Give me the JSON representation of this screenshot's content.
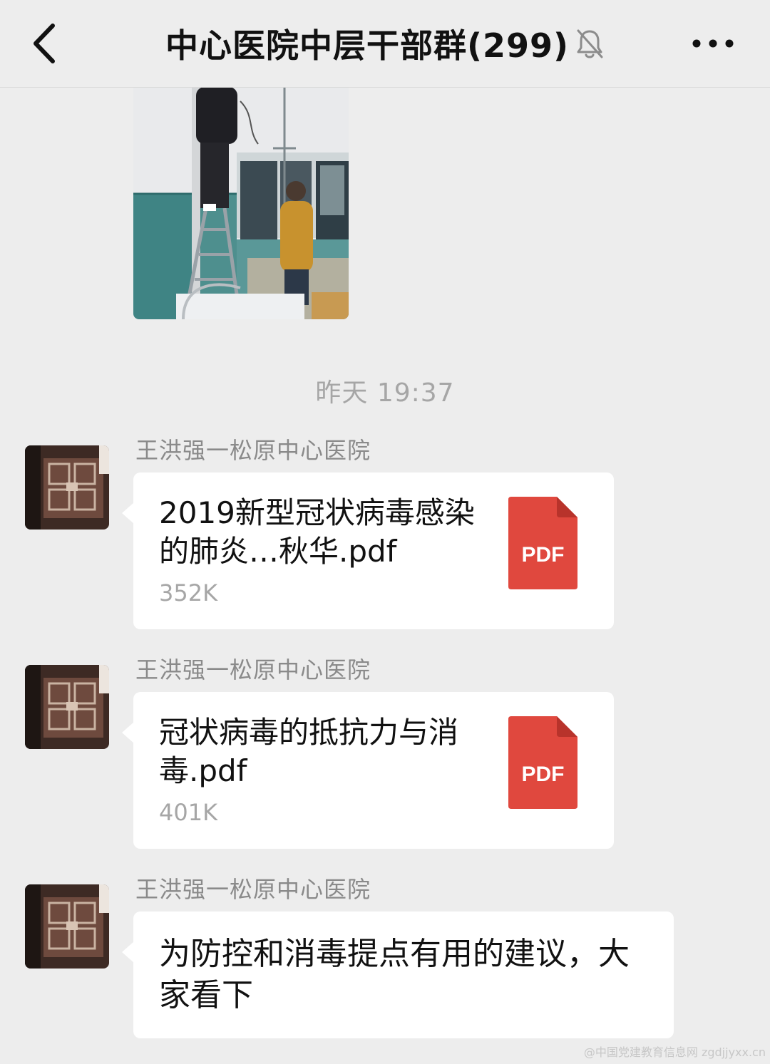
{
  "header": {
    "title": "中心医院中层干部群(299)"
  },
  "time_divider": "昨天 19:37",
  "messages": [
    {
      "sender": "王洪强一松原中心医院",
      "file_name": "2019新型冠状病毒感染的肺炎…秋华.pdf",
      "file_size": "352K",
      "file_type": "PDF"
    },
    {
      "sender": "王洪强一松原中心医院",
      "file_name": "冠状病毒的抵抗力与消毒.pdf",
      "file_size": "401K",
      "file_type": "PDF"
    },
    {
      "sender": "王洪强一松原中心医院",
      "text": "为防控和消毒提点有用的建议，大家看下"
    }
  ],
  "watermark": "@中国党建教育信息网 zgdjjyxx.cn",
  "colors": {
    "page_background": "#ededed",
    "bubble": "#ffffff",
    "pdf_icon": "#e0483e",
    "secondary_text": "#a6a6a6"
  },
  "icons": {
    "back": "chevron-left-icon",
    "mute": "bell-off-icon",
    "more": "more-dots-icon",
    "file": "pdf-file-icon"
  }
}
